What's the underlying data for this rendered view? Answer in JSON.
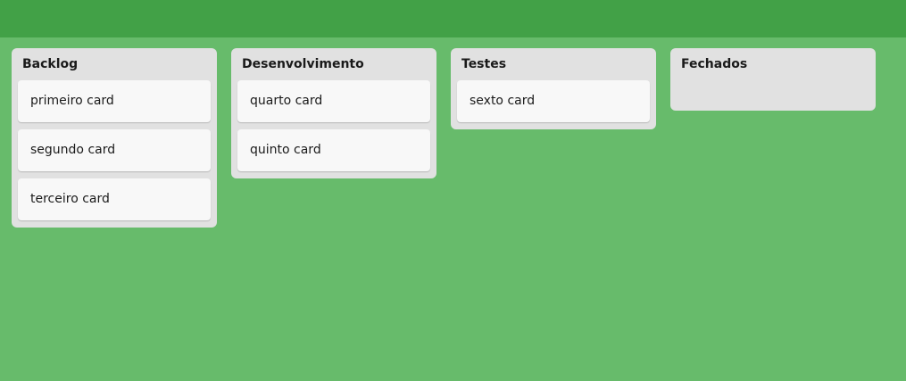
{
  "header": {
    "color": "#42a147"
  },
  "board": {
    "background": "#67bb6b",
    "lists": [
      {
        "title": "Backlog",
        "cards": [
          "primeiro card",
          "segundo card",
          "terceiro card"
        ]
      },
      {
        "title": "Desenvolvimento",
        "cards": [
          "quarto card",
          "quinto card"
        ]
      },
      {
        "title": "Testes",
        "cards": [
          "sexto card"
        ]
      },
      {
        "title": "Fechados",
        "cards": []
      }
    ]
  }
}
